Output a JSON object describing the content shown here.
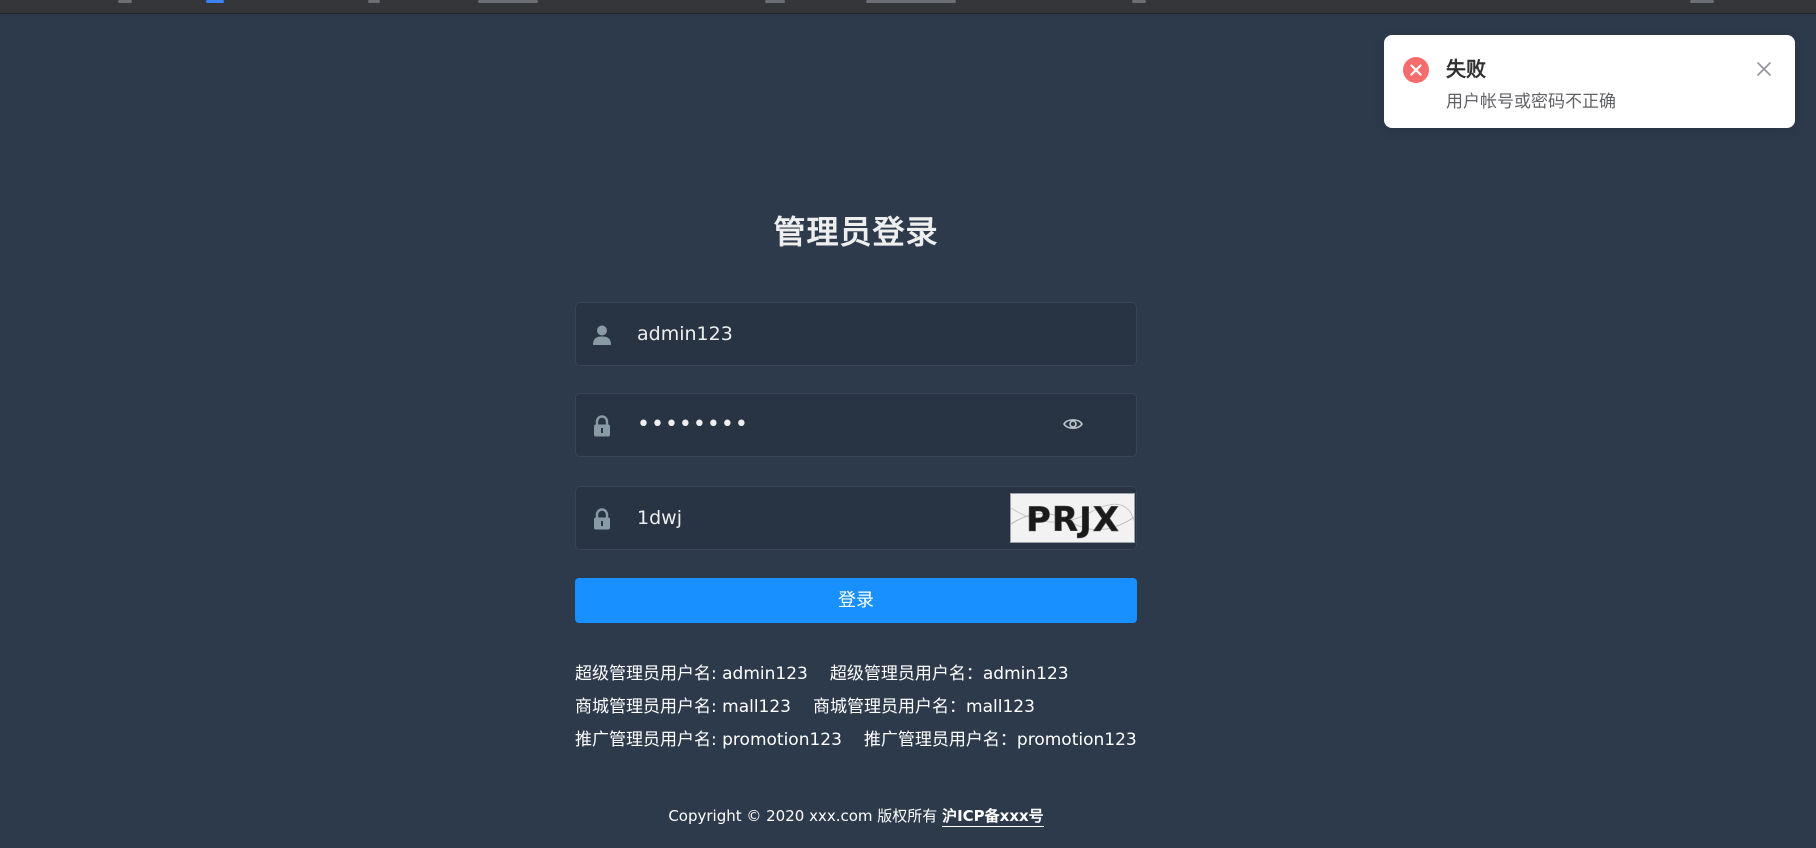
{
  "login": {
    "title": "管理员登录",
    "username": {
      "value": "admin123",
      "icon": "user-icon"
    },
    "password": {
      "value": "••••••••",
      "icon": "lock-icon",
      "toggle_icon": "eye-icon"
    },
    "captcha": {
      "value": "1dwj",
      "icon": "lock-icon",
      "image_text": "PRJX"
    },
    "submit_label": "登录"
  },
  "tips": [
    {
      "left": "超级管理员用户名: admin123",
      "right": "超级管理员用户名：admin123"
    },
    {
      "left": "商城管理员用户名: mall123",
      "right": "商城管理员用户名：mall123"
    },
    {
      "left": "推广管理员用户名: promotion123",
      "right": "推广管理员用户名：promotion123"
    }
  ],
  "footer": {
    "copyright": "Copyright © 2020 xxx.com 版权所有",
    "icp": "沪ICP备xxx号"
  },
  "notification": {
    "type": "error",
    "icon": "error-circle-icon",
    "title": "失败",
    "message": "用户帐号或密码不正确",
    "close_icon": "close-icon"
  },
  "colors": {
    "page_bg": "#2d3a4b",
    "input_bg": "#283443",
    "primary": "#1890ff",
    "error": "#f56c6c"
  }
}
